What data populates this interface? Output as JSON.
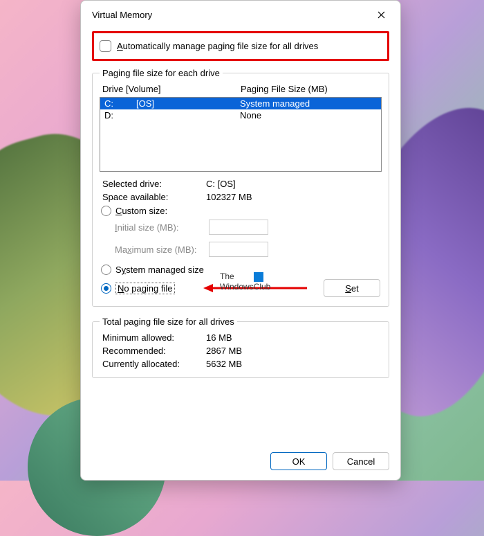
{
  "window": {
    "title": "Virtual Memory"
  },
  "auto_manage": {
    "label_pre": "A",
    "label_rest": "utomatically manage paging file size for all drives",
    "checked": false
  },
  "drive_section": {
    "legend": "Paging file size for each drive",
    "header_drive": "Drive  [Volume]",
    "header_size": "Paging File Size (MB)",
    "rows": [
      {
        "drive": "C:",
        "volume": "[OS]",
        "size": "System managed",
        "selected": true
      },
      {
        "drive": "D:",
        "volume": "",
        "size": "None",
        "selected": false
      }
    ],
    "selected_drive_label": "Selected drive:",
    "selected_drive_value": "C:  [OS]",
    "space_available_label": "Space available:",
    "space_available_value": "102327 MB",
    "custom_u": "C",
    "custom_rest": "ustom size:",
    "initial_u": "I",
    "initial_rest": "nitial size (MB):",
    "max_pre": "Ma",
    "max_u": "x",
    "max_rest": "imum size (MB):",
    "system_pre": "S",
    "system_u": "y",
    "system_rest": "stem managed size",
    "nopaging_u": "N",
    "nopaging_rest": "o paging file",
    "set_u": "S",
    "set_rest": "et",
    "selected_radio": "nopaging"
  },
  "totals": {
    "legend": "Total paging file size for all drives",
    "min_label": "Minimum allowed:",
    "min_value": "16 MB",
    "rec_label": "Recommended:",
    "rec_value": "2867 MB",
    "cur_label": "Currently allocated:",
    "cur_value": "5632 MB"
  },
  "buttons": {
    "ok": "OK",
    "cancel": "Cancel"
  },
  "watermark": {
    "line1": "The",
    "line2": "WindowsClub"
  }
}
